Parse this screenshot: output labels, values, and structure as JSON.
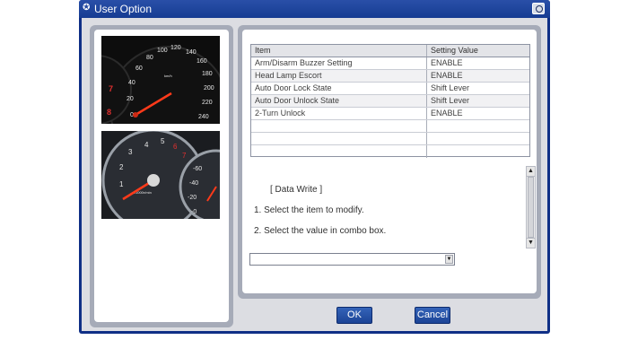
{
  "window": {
    "title": "User Option",
    "title_icon": "app-icon",
    "close_icon": "close-icon"
  },
  "images": [
    {
      "name": "speedometer-gauge-image"
    },
    {
      "name": "tachometer-gauge-image"
    }
  ],
  "grid": {
    "headers": [
      "Item",
      "Setting Value"
    ],
    "rows": [
      {
        "item": "Arm/Disarm Buzzer Setting",
        "value": "ENABLE"
      },
      {
        "item": "Head Lamp Escort",
        "value": "ENABLE"
      },
      {
        "item": "Auto Door Lock State",
        "value": "Shift Lever"
      },
      {
        "item": "Auto Door Unlock State",
        "value": "Shift Lever"
      },
      {
        "item": "2-Turn Unlock",
        "value": "ENABLE"
      },
      {
        "item": "",
        "value": ""
      },
      {
        "item": "",
        "value": ""
      },
      {
        "item": "",
        "value": ""
      }
    ]
  },
  "instructions": {
    "title": "[ Data Write ]",
    "line1": "1. Select the item to modify.",
    "line2": "2. Select the value in combo box."
  },
  "combo": {
    "value": ""
  },
  "buttons": {
    "ok": "OK",
    "cancel": "Cancel"
  },
  "gauge_labels": {
    "speedo": [
      "0",
      "20",
      "40",
      "60",
      "80",
      "100",
      "120",
      "140",
      "160",
      "180",
      "200",
      "220",
      "240"
    ],
    "speedo_unit": "km/h",
    "tacho": [
      "1",
      "2",
      "3",
      "4",
      "5",
      "6",
      "7"
    ],
    "tacho_unit": "x1000r/min"
  },
  "colors": {
    "window_frame": "#0f2f86",
    "button": "#2a56ad",
    "panel": "#a6abb8"
  }
}
